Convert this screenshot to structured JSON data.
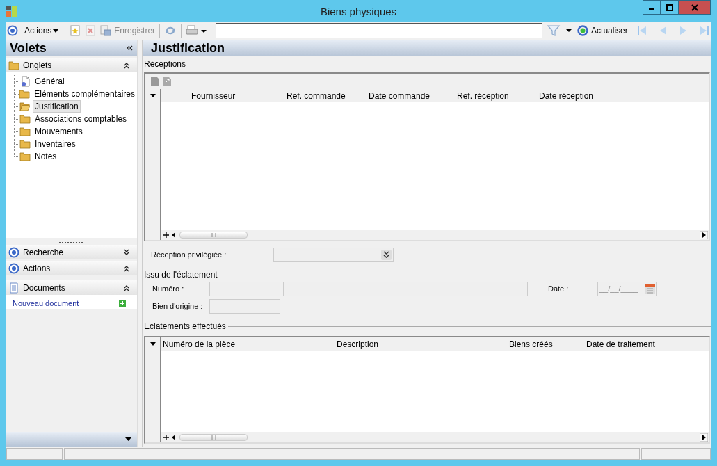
{
  "window": {
    "title": "Biens physiques"
  },
  "toolbar": {
    "actions_menu": "Actions",
    "save_button": {
      "label": "Enregistrer",
      "disabled": true
    },
    "refresh_button": "Actualiser"
  },
  "sidebar": {
    "title": "Volets",
    "sections": [
      {
        "label": "Onglets",
        "kind": "tree",
        "expanded": true,
        "items": [
          {
            "label": "Général",
            "kind": "document",
            "selected": false
          },
          {
            "label": "Eléments complémentaires",
            "kind": "folder",
            "selected": false
          },
          {
            "label": "Justification",
            "kind": "folder",
            "selected": true
          },
          {
            "label": "Associations comptables",
            "kind": "folder",
            "selected": false
          },
          {
            "label": "Mouvements",
            "kind": "folder",
            "selected": false
          },
          {
            "label": "Inventaires",
            "kind": "folder",
            "selected": false
          },
          {
            "label": "Notes",
            "kind": "folder",
            "selected": false
          }
        ]
      },
      {
        "label": "Recherche",
        "kind": "panel",
        "expanded": false
      },
      {
        "label": "Actions",
        "kind": "panel",
        "expanded": true
      },
      {
        "label": "Documents",
        "kind": "documents",
        "expanded": true,
        "links": [
          "Nouveau document"
        ]
      }
    ]
  },
  "main": {
    "title": "Justification",
    "receptions": {
      "label": "Réceptions",
      "columns": [
        "Fournisseur",
        "Ref. commande",
        "Date commande",
        "Ref. réception",
        "Date réception"
      ]
    },
    "preferred_reception": {
      "label": "Réception privilégiée :"
    },
    "origin": {
      "label": "Issu de l'éclatement",
      "number_label": "Numéro :",
      "date_label": "Date :",
      "date_placeholder": "__/__/____",
      "origin_label": "Bien d'origine :"
    },
    "splits": {
      "label": "Eclatements effectués",
      "columns": [
        "Numéro de la pièce",
        "Description",
        "Biens créés",
        "Date de traitement"
      ]
    }
  }
}
